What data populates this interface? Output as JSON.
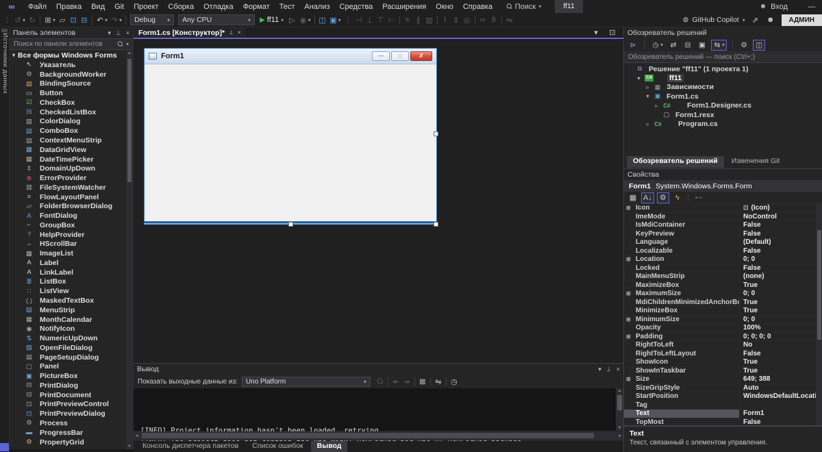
{
  "glyphs": {
    "caret": "▾",
    "magnifier": "Ϙ",
    "person": "☻",
    "pin": "⊥",
    "close": "×",
    "expand": "⊞",
    "cs": "C#",
    "up_arrow": "▲",
    "down_arrow": "▼",
    "left_arrow": "◂",
    "right_arrow": "▸",
    "collapsed_arrow": "▹",
    "expanded_arrow": "▾",
    "play": "▶",
    "play_outline": "▷",
    "icon_box": "⊡",
    "grip": "⋮",
    "logo": "∞",
    "copilot": "⊚",
    "minimize": "—",
    "form_glyph": "⊡"
  },
  "colors": {
    "accent": "#6a62d8",
    "run_green": "#3fc23f",
    "admin_bg": "#dcdcdc",
    "error_red": "#e05252",
    "icon_blue": "#6ba3d6"
  },
  "menu_bar": {
    "items": [
      "Файл",
      "Правка",
      "Вид",
      "Git",
      "Проект",
      "Сборка",
      "Отладка",
      "Формат",
      "Тест",
      "Анализ",
      "Средства",
      "Расширения",
      "Окно",
      "Справка"
    ],
    "search_label": "Поиск",
    "solution_badge": "ff11",
    "sign_in_label": "Вход"
  },
  "toolbar": {
    "debug_value": "Debug",
    "platform_value": "Any CPU",
    "run_label": "ff11",
    "copilot_label": "GitHub Copilot",
    "admin_label": "АДМИН",
    "icons_a": [
      {
        "name": "toolbar-grip",
        "glyph": "⋮",
        "dim": true
      },
      {
        "name": "navigate-back-icon",
        "glyph": "↺",
        "dim": true,
        "caret": true
      },
      {
        "name": "navigate-forward-icon",
        "glyph": "↻",
        "dim": true
      },
      {
        "sep": true
      },
      {
        "name": "new-project-icon",
        "glyph": "⊞",
        "caret": true
      },
      {
        "name": "open-file-icon",
        "glyph": "▱",
        "color": "#d8b36a"
      },
      {
        "name": "save-icon",
        "glyph": "⊡",
        "color": "#5ea3e0"
      },
      {
        "name": "save-all-icon",
        "glyph": "⊟",
        "color": "#5ea3e0"
      },
      {
        "sep": true
      },
      {
        "name": "undo-icon",
        "glyph": "↶",
        "caret": true
      },
      {
        "name": "redo-icon",
        "glyph": "↷",
        "dim": true,
        "caret": true
      },
      {
        "sep": true
      }
    ],
    "icons_b": [
      {
        "name": "profiler-icon",
        "glyph": "◉",
        "dim": true,
        "caret": true
      },
      {
        "sep": true
      },
      {
        "name": "toolbox-panel-icon",
        "glyph": "◫",
        "color": "#5ea3e0"
      },
      {
        "name": "solution-panel-icon",
        "glyph": "▣",
        "color": "#5ea3e0",
        "caret": true
      },
      {
        "name": "toolbar-grip",
        "glyph": "⋮",
        "dim": true
      }
    ],
    "align_icons": [
      {
        "name": "layout-tool-icon",
        "glyph": "⊣",
        "dim": true
      },
      {
        "name": "layout-tool-icon",
        "glyph": "⊥",
        "dim": true
      },
      {
        "name": "layout-tool-icon",
        "glyph": "⊤",
        "dim": true
      },
      {
        "name": "layout-tool-icon",
        "glyph": "⊢",
        "dim": true
      },
      {
        "sep": true
      },
      {
        "name": "layout-tool-icon",
        "glyph": "≡",
        "dim": true
      },
      {
        "name": "layout-tool-icon",
        "glyph": "∥",
        "dim": true
      },
      {
        "name": "layout-tool-icon",
        "glyph": "▥",
        "dim": true
      },
      {
        "sep": true
      },
      {
        "name": "layout-tool-icon",
        "glyph": "I",
        "dim": true
      },
      {
        "name": "layout-tool-icon",
        "glyph": "⇕",
        "dim": true
      },
      {
        "name": "layout-tool-icon",
        "glyph": "◎",
        "dim": true
      },
      {
        "sep": true
      },
      {
        "name": "layout-tool-icon",
        "glyph": "∞",
        "dim": true
      },
      {
        "name": "layout-tool-icon",
        "glyph": "8",
        "dim": true
      },
      {
        "sep": true
      },
      {
        "name": "layout-tool-icon",
        "glyph": "⇋",
        "dim": true
      }
    ]
  },
  "data_sources_tab": {
    "label": "Источники данных"
  },
  "toolbox": {
    "title": "Панель элементов",
    "search_placeholder": "Поиск по панели элементов",
    "group_label": "Все формы Windows Forms",
    "items": [
      {
        "label": "Указатель",
        "glyph": "↖",
        "color": "#e0e0e0"
      },
      {
        "label": "BackgroundWorker",
        "glyph": "⚙",
        "color": "#a8a8a8"
      },
      {
        "label": "BindingSource",
        "glyph": "▤",
        "color": "#d0a84f"
      },
      {
        "label": "Button",
        "glyph": "▭",
        "color": "#c8c8c8"
      },
      {
        "label": "CheckBox",
        "glyph": "☑",
        "color": "#8cc152"
      },
      {
        "label": "CheckedListBox",
        "glyph": "⊟",
        "color": "#6ba3d6"
      },
      {
        "label": "ColorDialog",
        "glyph": "▧",
        "color": "#a8a8a8"
      },
      {
        "label": "ComboBox",
        "glyph": "▤",
        "color": "#6ba3d6"
      },
      {
        "label": "ContextMenuStrip",
        "glyph": "▤",
        "color": "#a8a8a8"
      },
      {
        "label": "DataGridView",
        "glyph": "▦",
        "color": "#6ba3d6"
      },
      {
        "label": "DateTimePicker",
        "glyph": "▦",
        "color": "#a8a8a8"
      },
      {
        "label": "DomainUpDown",
        "glyph": "⇕",
        "color": "#a8a8a8"
      },
      {
        "label": "ErrorProvider",
        "glyph": "⊗",
        "color": "#e05252"
      },
      {
        "label": "FileSystemWatcher",
        "glyph": "▥",
        "color": "#a8a8a8"
      },
      {
        "label": "FlowLayoutPanel",
        "glyph": "≡",
        "color": "#a8a8a8"
      },
      {
        "label": "FolderBrowserDialog",
        "glyph": "▱",
        "color": "#d8b36a"
      },
      {
        "label": "FontDialog",
        "glyph": "A",
        "color": "#6ba3d6"
      },
      {
        "label": "GroupBox",
        "glyph": "⌐",
        "color": "#a8a8a8"
      },
      {
        "label": "HelpProvider",
        "glyph": "?",
        "color": "#5aa7f0"
      },
      {
        "label": "HScrollBar",
        "glyph": "⇔",
        "color": "#a8a8a8"
      },
      {
        "label": "ImageList",
        "glyph": "▦",
        "color": "#a8a8a8"
      },
      {
        "label": "Label",
        "glyph": "A",
        "color": "#d8d8d8"
      },
      {
        "label": "LinkLabel",
        "glyph": "A",
        "color": "#d8d8d8"
      },
      {
        "label": "ListBox",
        "glyph": "≣",
        "color": "#6ba3d6"
      },
      {
        "label": "ListView",
        "glyph": "∷",
        "color": "#a8a8a8"
      },
      {
        "label": "MaskedTextBox",
        "glyph": "(.)",
        "color": "#a8a8a8"
      },
      {
        "label": "MenuStrip",
        "glyph": "▤",
        "color": "#6ba3d6"
      },
      {
        "label": "MonthCalendar",
        "glyph": "▦",
        "color": "#a8a8a8"
      },
      {
        "label": "NotifyIcon",
        "glyph": "◉",
        "color": "#a8a8a8"
      },
      {
        "label": "NumericUpDown",
        "glyph": "⇅",
        "color": "#6ba3d6"
      },
      {
        "label": "OpenFileDialog",
        "glyph": "▨",
        "color": "#6ba3d6"
      },
      {
        "label": "PageSetupDialog",
        "glyph": "▤",
        "color": "#a8a8a8"
      },
      {
        "label": "Panel",
        "glyph": "▢",
        "color": "#a8a8a8"
      },
      {
        "label": "PictureBox",
        "glyph": "▣",
        "color": "#6ba3d6"
      },
      {
        "label": "PrintDialog",
        "glyph": "⊟",
        "color": "#a8a8a8"
      },
      {
        "label": "PrintDocument",
        "glyph": "⊟",
        "color": "#a8a8a8"
      },
      {
        "label": "PrintPreviewControl",
        "glyph": "⊡",
        "color": "#a8a8a8"
      },
      {
        "label": "PrintPreviewDialog",
        "glyph": "⊡",
        "color": "#6ba3d6"
      },
      {
        "label": "Process",
        "glyph": "⚙",
        "color": "#a8a8a8"
      },
      {
        "label": "ProgressBar",
        "glyph": "▬",
        "color": "#6ba3d6"
      },
      {
        "label": "PropertyGrid",
        "glyph": "⚙",
        "color": "#d8b36a"
      }
    ]
  },
  "editor": {
    "tab_label": "Form1.cs [Конструктор]*",
    "tab_icons": [
      {
        "name": "document-dropdown-icon",
        "glyph": "▾"
      },
      {
        "name": "float-icon",
        "glyph": "⊡"
      }
    ],
    "form_title": "Form1",
    "form_buttons": {
      "minimize": "—",
      "maximize": "□",
      "close": "✗"
    }
  },
  "output": {
    "title": "Вывод",
    "source_label": "Показать выходные данные из:",
    "source_value": "Uno Platform",
    "icons": [
      {
        "name": "find-message-icon",
        "glyph": "Ϙ",
        "dim": true,
        "mag": true
      },
      {
        "sep": true
      },
      {
        "name": "prev-message-icon",
        "glyph": "↞",
        "dim": true
      },
      {
        "name": "next-message-icon",
        "glyph": "↠",
        "dim": true
      },
      {
        "sep": true
      },
      {
        "name": "clear-all-icon",
        "glyph": "⊠"
      },
      {
        "sep": true
      },
      {
        "name": "word-wrap-icon",
        "glyph": "⇋"
      },
      {
        "sep": true
      },
      {
        "name": "timestamp-icon",
        "glyph": "◷"
      }
    ],
    "lines": [
      "[INFO] Project information hasn't been loaded, retrying...",
      "[INFO] The project does not contain the Uno.WinUI.DevServer nor Uno.UI.DevServer package."
    ],
    "bottom_tabs": [
      {
        "label": "Консоль диспетчера пакетов"
      },
      {
        "label": "Список ошибок"
      },
      {
        "label": "Вывод",
        "active": true
      }
    ]
  },
  "solution_explorer": {
    "title": "Обозреватель решений",
    "toolbar_icons": [
      {
        "name": "switch-views-icon",
        "glyph": "⊳",
        "color": "#b18be8"
      },
      {
        "sep": true
      },
      {
        "name": "pending-changes-filter-icon",
        "glyph": "◷",
        "caret": true
      },
      {
        "name": "sync-icon",
        "glyph": "⇄"
      },
      {
        "name": "collapse-all-icon",
        "glyph": "⊟"
      },
      {
        "name": "properties-icon",
        "glyph": "▣"
      },
      {
        "name": "sync-with-active-icon",
        "glyph": "⇆",
        "boxed": true,
        "caret": true
      },
      {
        "sep": true
      },
      {
        "name": "wrench-icon",
        "glyph": "⚙"
      },
      {
        "name": "preview-icon",
        "glyph": "◫",
        "boxed": true
      }
    ],
    "search_placeholder": "Обозреватель решений — поиск (Ctrl+;)",
    "tree": [
      {
        "label": "Решение \"ff11\" (1 проекта 1)",
        "glyph": "⧉",
        "color": "#b18be8",
        "indent": 0
      },
      {
        "label": "ff11",
        "arrow": "▾",
        "csbox": true,
        "indent": 1,
        "selected": true,
        "bold": true
      },
      {
        "label": "Зависимости",
        "arrow": "▹",
        "glyph": "▦",
        "color": "#9e9e9e",
        "indent": 2
      },
      {
        "label": "Form1.cs",
        "arrow": "▾",
        "glyph": "▣",
        "color": "#5ea3e0",
        "indent": 2
      },
      {
        "label": "Form1.Designer.cs",
        "arrow": "▹",
        "cs": true,
        "indent": 3
      },
      {
        "label": "Form1.resx",
        "glyph": "▢",
        "color": "#c0c0c0",
        "indent": 3
      },
      {
        "label": "Program.cs",
        "arrow": "▹",
        "cs": true,
        "indent": 2
      }
    ],
    "bottom_tabs": [
      {
        "label": "Обозреватель решений",
        "active": true
      },
      {
        "label": "Изменения Git"
      }
    ]
  },
  "properties": {
    "title": "Свойства",
    "object_name": "Form1",
    "object_type": "System.Windows.Forms.Form",
    "toolbar_icons": [
      {
        "name": "categorized-icon",
        "glyph": "▦"
      },
      {
        "name": "alphabetical-icon",
        "glyph": "A↓",
        "boxed": true
      },
      {
        "name": "properties-view-icon",
        "glyph": "⚙",
        "boxed": true
      },
      {
        "name": "events-icon",
        "glyph": "ϟ",
        "color": "#e8c84a"
      },
      {
        "sep": true
      },
      {
        "name": "property-pages-icon",
        "glyph": "⊷",
        "dim": true
      }
    ],
    "rows": [
      {
        "name": "Icon",
        "value": "(Icon)",
        "expand": true,
        "icon_glyph": true
      },
      {
        "name": "ImeMode",
        "value": "NoControl"
      },
      {
        "name": "IsMdiContainer",
        "value": "False"
      },
      {
        "name": "KeyPreview",
        "value": "False"
      },
      {
        "name": "Language",
        "value": "(Default)"
      },
      {
        "name": "Localizable",
        "value": "False"
      },
      {
        "name": "Location",
        "value": "0; 0",
        "expand": true
      },
      {
        "name": "Locked",
        "value": "False"
      },
      {
        "name": "MainMenuStrip",
        "value": "(none)"
      },
      {
        "name": "MaximizeBox",
        "value": "True"
      },
      {
        "name": "MaximumSize",
        "value": "0; 0",
        "expand": true
      },
      {
        "name": "MdiChildrenMinimizedAnchorBottom",
        "value": "True"
      },
      {
        "name": "MinimizeBox",
        "value": "True"
      },
      {
        "name": "MinimumSize",
        "value": "0; 0",
        "expand": true
      },
      {
        "name": "Opacity",
        "value": "100%"
      },
      {
        "name": "Padding",
        "value": "0; 0; 0; 0",
        "expand": true
      },
      {
        "name": "RightToLeft",
        "value": "No"
      },
      {
        "name": "RightToLeftLayout",
        "value": "False"
      },
      {
        "name": "ShowIcon",
        "value": "True"
      },
      {
        "name": "ShowInTaskbar",
        "value": "True"
      },
      {
        "name": "Size",
        "value": "649; 388",
        "expand": true
      },
      {
        "name": "SizeGripStyle",
        "value": "Auto"
      },
      {
        "name": "StartPosition",
        "value": "WindowsDefaultLocation"
      },
      {
        "name": "Tag",
        "value": ""
      },
      {
        "name": "Text",
        "value": "Form1",
        "selected": true
      },
      {
        "name": "TopMost",
        "value": "False"
      }
    ],
    "description_title": "Text",
    "description_text": "Текст, связанный с элементом управления."
  }
}
